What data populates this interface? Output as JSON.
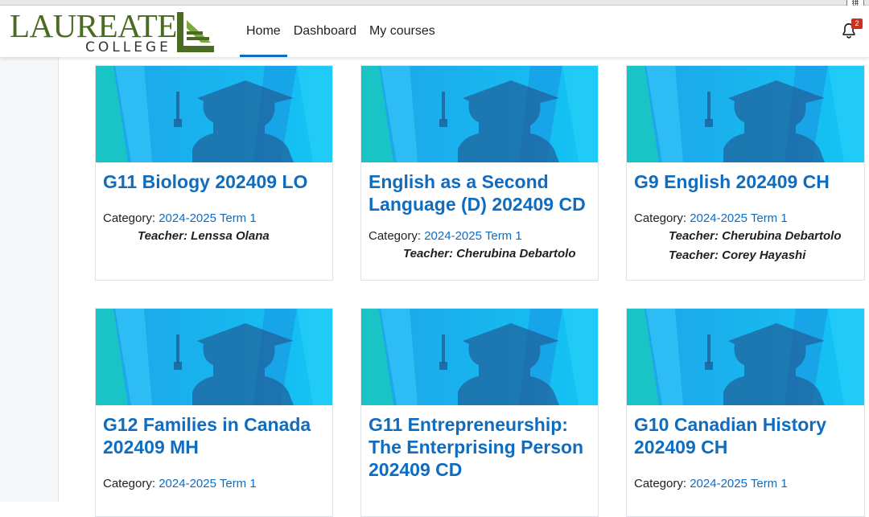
{
  "ime_label": "拼",
  "logo": {
    "word": "LAUREATE",
    "sub": "COLLEGE"
  },
  "nav": [
    {
      "label": "Home",
      "active": true
    },
    {
      "label": "Dashboard",
      "active": false
    },
    {
      "label": "My courses",
      "active": false
    }
  ],
  "notifications": {
    "count": "2",
    "icon": "bell-icon"
  },
  "colors": {
    "accent": "#0f6cbf",
    "logo_green": "#4a6b22",
    "badge": "#ca3120"
  },
  "category_label": "Category:",
  "teacher_label": "Teacher:",
  "courses": [
    {
      "title": "G11 Biology 202409 LO",
      "category": "2024-2025 Term 1",
      "teachers": [
        "Lenssa Olana"
      ]
    },
    {
      "title": "English as a Second Language (D) 202409 CD",
      "category": "2024-2025 Term 1",
      "teachers": [
        "Cherubina Debartolo"
      ]
    },
    {
      "title": "G9 English 202409 CH",
      "category": "2024-2025 Term 1",
      "teachers": [
        "Cherubina Debartolo",
        "Corey Hayashi"
      ]
    },
    {
      "title": "G12 Families in Canada 202409 MH",
      "category": "2024-2025 Term 1",
      "teachers": []
    },
    {
      "title": "G11 Entrepreneurship: The Enterprising Person 202409 CD",
      "category": "",
      "teachers": []
    },
    {
      "title": "G10 Canadian History 202409 CH",
      "category": "2024-2025 Term 1",
      "teachers": []
    }
  ]
}
